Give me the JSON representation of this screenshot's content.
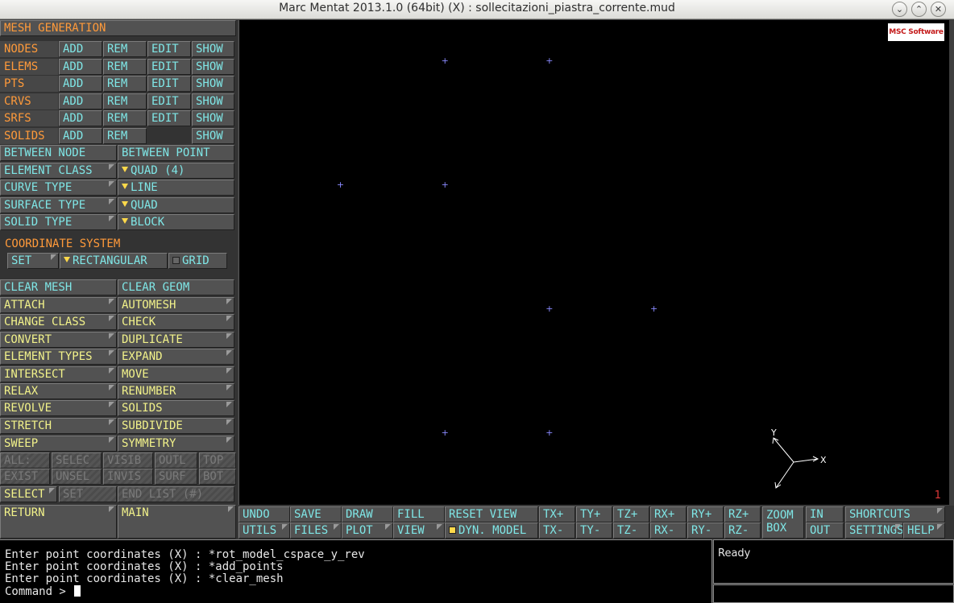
{
  "window": {
    "title": "Marc Mentat 2013.1.0 (64bit) (X) : sollecitazioni_piastra_corrente.mud",
    "buttons": [
      "⌄",
      "⌃",
      "✕"
    ]
  },
  "panel": {
    "title": "MESH GENERATION",
    "rows": [
      {
        "label": "NODES",
        "buttons": [
          "ADD",
          "REM",
          "EDIT",
          "SHOW"
        ]
      },
      {
        "label": "ELEMS",
        "buttons": [
          "ADD",
          "REM",
          "EDIT",
          "SHOW"
        ]
      },
      {
        "label": "PTS",
        "buttons": [
          "ADD",
          "REM",
          "EDIT",
          "SHOW"
        ]
      },
      {
        "label": "CRVS",
        "buttons": [
          "ADD",
          "REM",
          "EDIT",
          "SHOW"
        ]
      },
      {
        "label": "SRFS",
        "buttons": [
          "ADD",
          "REM",
          "EDIT",
          "SHOW"
        ]
      },
      {
        "label": "SOLIDS",
        "buttons": [
          "ADD",
          "REM",
          "",
          "SHOW"
        ]
      }
    ],
    "between_node": "BETWEEN NODE",
    "between_point": "BETWEEN POINT",
    "type_rows": [
      {
        "label": "ELEMENT CLASS",
        "value": "QUAD (4)"
      },
      {
        "label": "CURVE TYPE",
        "value": "LINE"
      },
      {
        "label": "SURFACE TYPE",
        "value": "QUAD"
      },
      {
        "label": "SOLID TYPE",
        "value": "BLOCK"
      }
    ],
    "coord_title": "COORDINATE SYSTEM",
    "coord_set": "SET",
    "coord_value": "RECTANGULAR",
    "coord_grid": "GRID",
    "clear_mesh": "CLEAR MESH",
    "clear_geom": "CLEAR GEOM",
    "ops": [
      [
        "ATTACH",
        "AUTOMESH"
      ],
      [
        "CHANGE CLASS",
        "CHECK"
      ],
      [
        "CONVERT",
        "DUPLICATE"
      ],
      [
        "ELEMENT TYPES",
        "EXPAND"
      ],
      [
        "INTERSECT",
        "MOVE"
      ],
      [
        "RELAX",
        "RENUMBER"
      ],
      [
        "REVOLVE",
        "SOLIDS"
      ],
      [
        "STRETCH",
        "SUBDIVIDE"
      ],
      [
        "SWEEP",
        "SYMMETRY"
      ]
    ],
    "sel_row1": [
      "ALL:",
      "SELEC",
      "VISIB",
      "OUTL",
      "TOP"
    ],
    "sel_row2": [
      "EXIST",
      "UNSEL",
      "INVIS",
      "SURF",
      "BOT"
    ],
    "select": "SELECT",
    "set": "SET",
    "end_list": "END LIST (#)",
    "return": "RETURN",
    "main": "MAIN"
  },
  "viewport": {
    "logo": "MSC Software",
    "page_number": "1",
    "axis_x": "X",
    "axis_y": "Y",
    "point_marker": "+",
    "points": [
      {
        "x": 1,
        "y": 3
      },
      {
        "x": 2,
        "y": 3
      },
      {
        "x": 0,
        "y": 2
      },
      {
        "x": 1,
        "y": 2
      },
      {
        "x": 2,
        "y": 1
      },
      {
        "x": 3,
        "y": 1
      },
      {
        "x": 1,
        "y": 0
      },
      {
        "x": 2,
        "y": 0
      }
    ]
  },
  "toolbar": {
    "undo": "UNDO",
    "utils": "UTILS",
    "save": "SAVE",
    "files": "FILES",
    "draw": "DRAW",
    "plot": "PLOT",
    "fill": "FILL",
    "view": "VIEW",
    "reset_view": "RESET VIEW",
    "dyn_model": "DYN. MODEL",
    "tx_plus": "TX+",
    "tx_minus": "TX-",
    "ty_plus": "TY+",
    "ty_minus": "TY-",
    "tz_plus": "TZ+",
    "tz_minus": "TZ-",
    "rx_plus": "RX+",
    "rx_minus": "RX-",
    "ry_plus": "RY+",
    "ry_minus": "RY-",
    "rz_plus": "RZ+",
    "rz_minus": "RZ-",
    "zoom_box_1": "ZOOM",
    "zoom_box_2": "BOX",
    "in": "IN",
    "out": "OUT",
    "shortcuts": "SHORTCUTS",
    "settings": "SETTINGS",
    "help": "HELP"
  },
  "console": {
    "lines": [
      "Enter point coordinates (X) : *rot_model_cspace_y_rev",
      "Enter point coordinates (X) : *add_points",
      "Enter point coordinates (X) : *clear_mesh"
    ],
    "prompt": "Command > "
  },
  "status": "Ready"
}
